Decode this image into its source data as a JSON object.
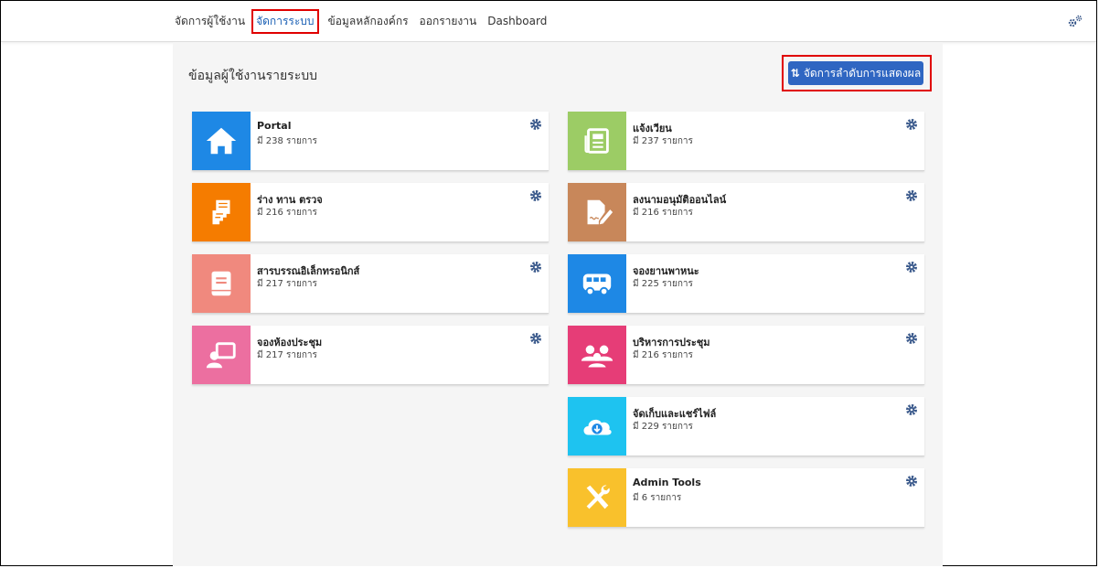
{
  "nav": {
    "items": [
      {
        "label": "จัดการผู้ใช้งาน",
        "active": false
      },
      {
        "label": "จัดการระบบ",
        "active": true
      },
      {
        "label": "ข้อมูลหลักองค์กร",
        "active": false
      },
      {
        "label": "ออกรายงาน",
        "active": false
      },
      {
        "label": "Dashboard",
        "active": false
      }
    ],
    "settings_icon": "gears-icon"
  },
  "page": {
    "title": "ข้อมูลผู้ใช้งานรายระบบ",
    "order_button_label": "จัดการลำดับการแสดงผล",
    "order_button_icon": "sort-arrows-icon"
  },
  "systems": [
    {
      "name": "Portal",
      "count": "มี 238 รายการ",
      "color": "#1e88e5",
      "icon": "home-icon"
    },
    {
      "name": "แจ้งเวียน",
      "count": "มี 237 รายการ",
      "color": "#9ccc65",
      "icon": "newspaper-icon"
    },
    {
      "name": "ร่าง ทาน ตรวจ",
      "count": "มี 216 รายการ",
      "color": "#f57c00",
      "icon": "document-stack-icon"
    },
    {
      "name": "ลงนามอนุมัติออนไลน์",
      "count": "มี 216 รายการ",
      "color": "#c8875a",
      "icon": "signature-icon"
    },
    {
      "name": "สารบรรณอิเล็กทรอนิกส์",
      "count": "มี 217 รายการ",
      "color": "#f0897e",
      "icon": "book-icon"
    },
    {
      "name": "จองยานพาหนะ",
      "count": "มี 225 รายการ",
      "color": "#1e88e5",
      "icon": "bus-icon"
    },
    {
      "name": "จองห้องประชุม",
      "count": "มี 217 รายการ",
      "color": "#ec6fa0",
      "icon": "presentation-icon"
    },
    {
      "name": "บริหารการประชุม",
      "count": "มี 216 รายการ",
      "color": "#e63d77",
      "icon": "users-icon"
    },
    {
      "name": "จัดเก็บและแชร์ไฟล์",
      "count": "มี 229 รายการ",
      "color": "#1ec3f0",
      "icon": "cloud-download-icon"
    },
    {
      "name": "Admin Tools",
      "count": "มี 6 รายการ",
      "color": "#f9c12c",
      "icon": "tools-icon"
    }
  ],
  "colors": {
    "accent": "#2f66c2",
    "highlight": "#e00000",
    "gear": "#3b5a8c"
  }
}
